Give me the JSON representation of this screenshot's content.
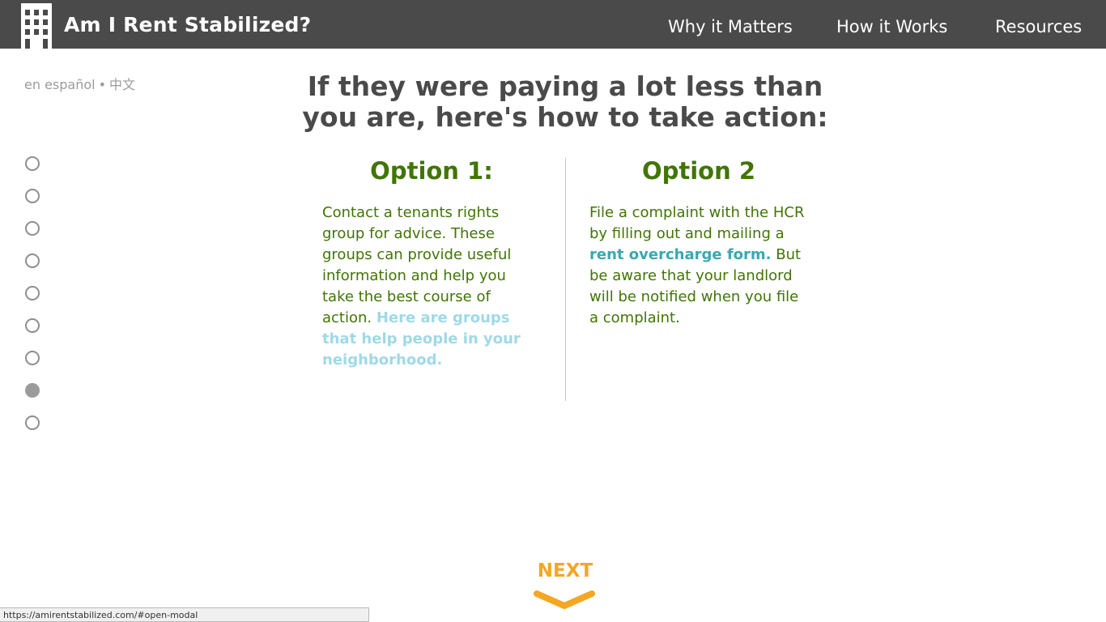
{
  "header": {
    "title": "Am I Rent Stabilized?",
    "nav": [
      "Why it Matters",
      "How it Works",
      "Resources"
    ]
  },
  "language": {
    "spanish": "en español",
    "separator": "•",
    "chinese": "中文"
  },
  "steps": {
    "total": 9,
    "active_index": 7
  },
  "main": {
    "heading_line1": "If they were paying a lot less than",
    "heading_line2": "you are, here's how to take action:"
  },
  "option1": {
    "title": "Option 1:",
    "text": "Contact a tenants rights group for advice. These groups can provide useful information and help you take the best course of action. ",
    "link": "Here are groups that help people in your neighborhood."
  },
  "option2": {
    "title": "Option 2",
    "text_before": "File a complaint with the HCR by filling out and mailing a ",
    "link": "rent overcharge form.",
    "text_after": " But be aware that your landlord will be notified when you file a complaint."
  },
  "next": {
    "label": "NEXT"
  },
  "status_bar": {
    "url": "https://amirentstabilized.com/#open-modal"
  },
  "colors": {
    "header_bg": "#4a4a4a",
    "heading": "#4a4a4a",
    "option_green": "#417505",
    "link_light_blue": "#9fd9e6",
    "link_teal": "#3aa8b0",
    "next_orange": "#f5a623",
    "dot_gray": "#8e8e8e"
  },
  "icons": {
    "logo": "building-icon",
    "next": "chevron-down-icon"
  }
}
